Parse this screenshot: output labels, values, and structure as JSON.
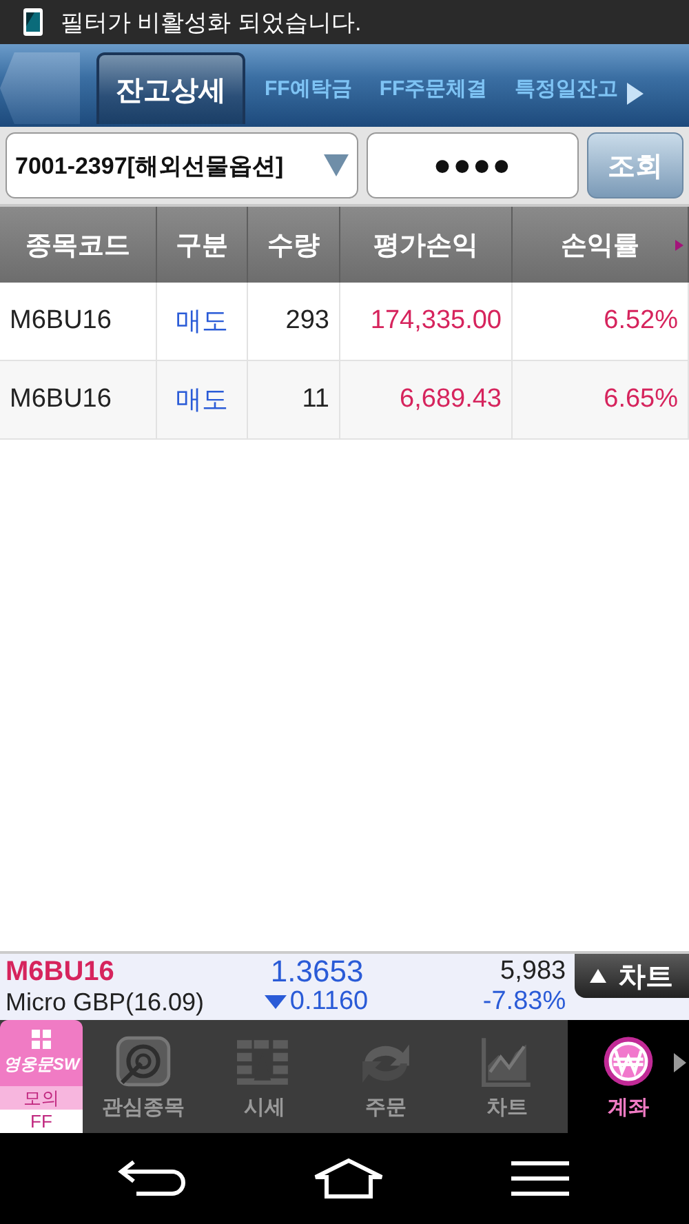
{
  "status_bar": {
    "message": "필터가 비활성화 되었습니다."
  },
  "tabs": [
    {
      "label": "잔고상세",
      "selected": true
    },
    {
      "label": "FF예탁금",
      "selected": false
    },
    {
      "label": "FF주문체결",
      "selected": false
    },
    {
      "label": "특정일잔고",
      "selected": false
    }
  ],
  "query": {
    "account": "7001-2397[해외선물옵션]",
    "password": "●●●●",
    "button": "조회"
  },
  "table": {
    "columns": [
      "종목코드",
      "구분",
      "수량",
      "평가손익",
      "손익률"
    ],
    "rows": [
      [
        "M6BU16",
        "매도",
        "293",
        "174,335.00",
        "6.52%"
      ],
      [
        "M6BU16",
        "매도",
        "11",
        "6,689.43",
        "6.65%"
      ]
    ]
  },
  "ticker": {
    "code": "M6BU16",
    "name": "Micro GBP(16.09)",
    "price": "1.3653",
    "falling": true,
    "change": "0.1160",
    "volume": "5,983",
    "rate": "-7.83%",
    "chart_button": "차트"
  },
  "dock": {
    "brand": {
      "logo": "영웅문SW",
      "mode": "모의",
      "market": "FF"
    },
    "items": [
      {
        "label": "관심종목",
        "selected": false
      },
      {
        "label": "시세",
        "selected": false
      },
      {
        "label": "주문",
        "selected": false
      },
      {
        "label": "차트",
        "selected": false
      },
      {
        "label": "계좌",
        "selected": true
      }
    ]
  }
}
